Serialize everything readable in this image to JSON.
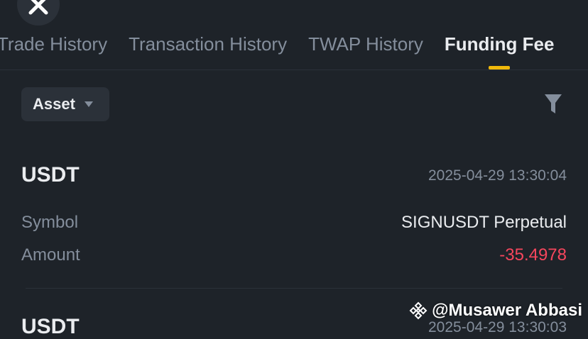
{
  "tabs": [
    {
      "label": "Trade History",
      "active": false
    },
    {
      "label": "Transaction History",
      "active": false
    },
    {
      "label": "TWAP History",
      "active": false
    },
    {
      "label": "Funding Fee",
      "active": true
    }
  ],
  "filter": {
    "asset_label": "Asset"
  },
  "records": [
    {
      "asset": "USDT",
      "time": "2025-04-29 13:30:04",
      "symbol_label": "Symbol",
      "symbol_value": "SIGNUSDT Perpetual",
      "amount_label": "Amount",
      "amount_value": "-35.4978"
    },
    {
      "asset": "USDT",
      "time": "2025-04-29 13:30:03"
    }
  ],
  "watermark": {
    "text": "@Musawer Abbasi"
  },
  "colors": {
    "background": "#1e2329",
    "accent": "#f0b90b",
    "negative": "#f6465d",
    "muted": "#848e9c"
  }
}
